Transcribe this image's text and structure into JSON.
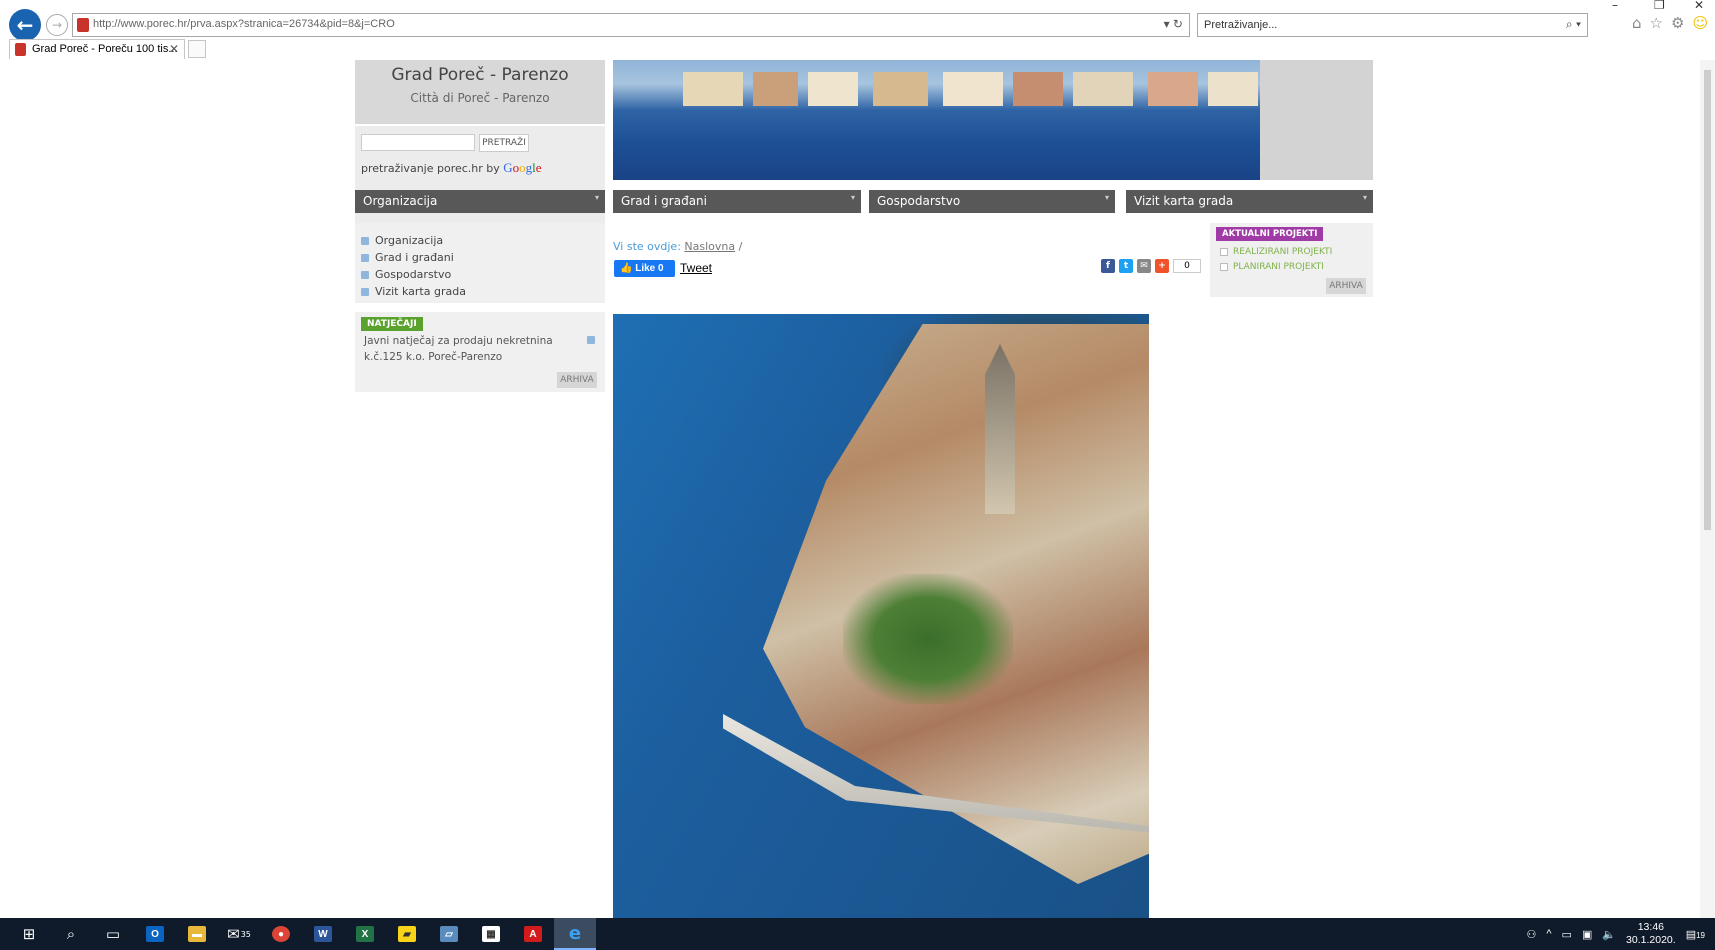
{
  "browser": {
    "url": "http://www.porec.hr/prva.aspx?stranica=26734&pid=8&j=CRO",
    "search_placeholder": "Pretraživanje...",
    "tab_title": "Grad Poreč - Poreču 100 tis..."
  },
  "site": {
    "title": "Grad Poreč - Parenzo",
    "subtitle": "Città di Poreč - Parenzo",
    "search_button": "PRETRAŽI",
    "search_caption": "pretraživanje porec.hr by",
    "google_label": "Google"
  },
  "nav": [
    {
      "label": "Organizacija"
    },
    {
      "label": "Grad i građani"
    },
    {
      "label": "Gospodarstvo"
    },
    {
      "label": "Vizit karta grada"
    }
  ],
  "left_menu": [
    {
      "label": "Organizacija"
    },
    {
      "label": "Grad i građani"
    },
    {
      "label": "Gospodarstvo"
    },
    {
      "label": "Vizit karta grada"
    }
  ],
  "natjecaji": {
    "badge": "NATJEČAJI",
    "text": "Javni natječaj za prodaju nekretnina k.č.125 k.o. Poreč-Parenzo",
    "archive": "ARHIVA"
  },
  "breadcrumb": {
    "prefix": "Vi ste ovdje:",
    "link": "Naslovna",
    "separator": "/"
  },
  "social": {
    "like": "Like 0",
    "tweet": "Tweet",
    "share_count": "0"
  },
  "projects": {
    "badge": "AKTUALNI PROJEKTI",
    "items": [
      {
        "label": "REALIZIRANI PROJEKTI"
      },
      {
        "label": "PLANIRANI PROJEKTI"
      }
    ],
    "archive": "ARHIVA"
  },
  "taskbar": {
    "mail_badge": "35",
    "time": "13:46",
    "date": "30.1.2020.",
    "notif_count": "19"
  },
  "colors": {
    "nav_bg": "#585858",
    "natjecaji": "#5aa12e",
    "projects": "#a03aa6",
    "link_blue": "#4a9bd6"
  }
}
